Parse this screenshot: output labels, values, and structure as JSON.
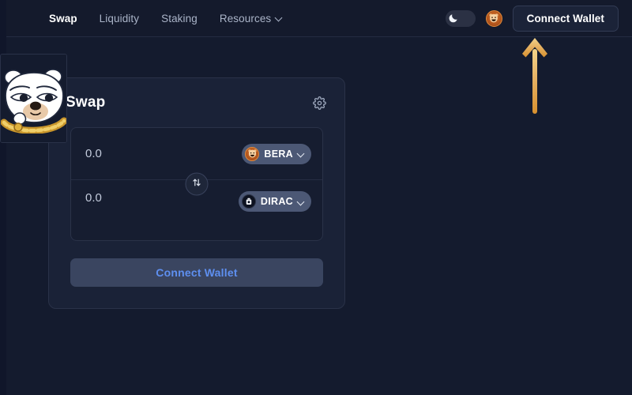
{
  "theme": {
    "page_bg": "#141b2e",
    "header_bg": "#141a2c",
    "card_bg": "#1a2237",
    "panel_bg": "#161d30",
    "border": "#2a3248",
    "accent_blue": "#5e8ff0",
    "accent_gold": "#e0a33c",
    "bera_orange": "#b1541c",
    "text_primary": "#ffffff",
    "text_muted": "#aab4c8"
  },
  "header": {
    "nav": [
      {
        "label": "Swap",
        "active": true,
        "has_chevron": false
      },
      {
        "label": "Liquidity",
        "active": false,
        "has_chevron": false
      },
      {
        "label": "Staking",
        "active": false,
        "has_chevron": false
      },
      {
        "label": "Resources",
        "active": false,
        "has_chevron": true
      }
    ],
    "theme_toggle": {
      "icon": "moon-icon",
      "state": "dark"
    },
    "token_icon": {
      "icon": "bera-token-icon",
      "label": "BERA"
    },
    "connect_wallet_label": "Connect Wallet"
  },
  "annotation": {
    "arrow": {
      "icon": "arrow-up-icon",
      "color": "#e0a33c",
      "points_to": "Connect Wallet"
    }
  },
  "mascot": {
    "name": "white-bear-meme-avatar",
    "description": "White bear with gold chain"
  },
  "swap_card": {
    "title": "Swap",
    "settings_icon": "gear-icon",
    "from": {
      "amount": "0.0",
      "placeholder": "0.0",
      "token": {
        "symbol": "BERA",
        "icon": "bera-token-icon"
      }
    },
    "to": {
      "amount": "0.0",
      "placeholder": "0.0",
      "token": {
        "symbol": "DIRAC",
        "icon": "dirac-token-icon"
      }
    },
    "direction_toggle_icon": "swap-arrows-icon",
    "cta_label": "Connect Wallet"
  }
}
